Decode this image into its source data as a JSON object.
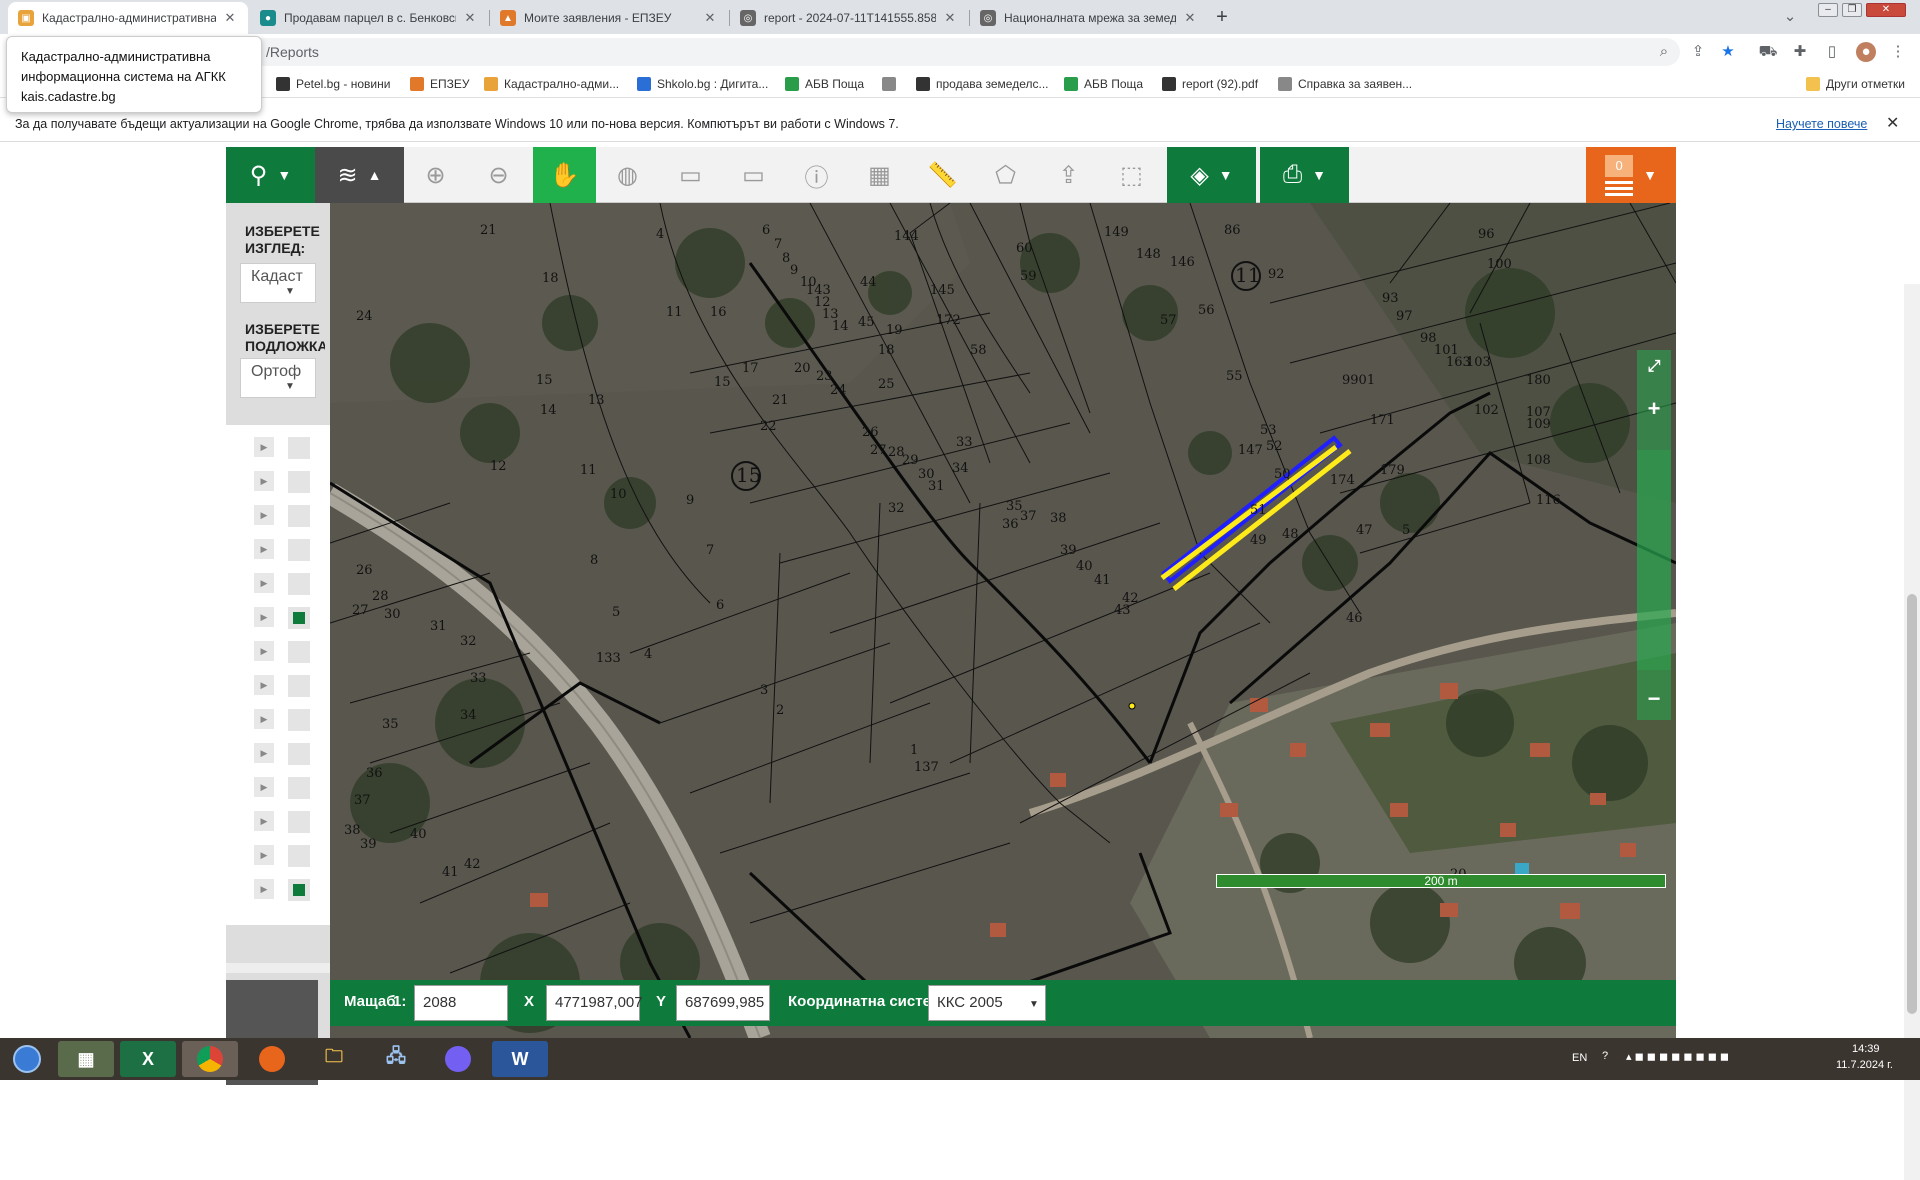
{
  "browser": {
    "tabs": [
      {
        "title": "Кадастрално-административна",
        "favicon_color": "#e8a33a",
        "active": true
      },
      {
        "title": "Продавам парцел в с. Бенковск",
        "favicon_color": "#1a8c8c",
        "active": false
      },
      {
        "title": "Моите заявления - ЕПЗЕУ",
        "favicon_color": "#e07a2a",
        "active": false
      },
      {
        "title": "report - 2024-07-11T141555.858",
        "favicon_color": "#666666",
        "active": false
      },
      {
        "title": "Националната мрежа за земед",
        "favicon_color": "#666666",
        "active": false
      }
    ],
    "tab_close": "✕",
    "new_tab": "+",
    "url_visible": "/Reports",
    "tooltip": {
      "line1": "Кадастрално-административна",
      "line2": "информационна система на АГКК",
      "line3": "kais.cadastre.bg"
    },
    "bookmarks": [
      {
        "label": "Petel.bg - новини",
        "color": "#333333"
      },
      {
        "label": "ЕПЗЕУ",
        "color": "#e07a2a"
      },
      {
        "label": "Кадастрално-адми...",
        "color": "#e8a33a"
      },
      {
        "label": "Shkolo.bg : Дигита...",
        "color": "#2a6fd6"
      },
      {
        "label": "АБВ Поща",
        "color": "#2a9d4b"
      },
      {
        "label": "",
        "color": "#888888"
      },
      {
        "label": "продава земеделс...",
        "color": "#333333"
      },
      {
        "label": "АБВ Поща",
        "color": "#2a9d4b"
      },
      {
        "label": "report (92).pdf",
        "color": "#333333"
      },
      {
        "label": "Справка за заявен...",
        "color": "#888888"
      }
    ],
    "other_bookmarks": "Други отметки",
    "infobar": {
      "message": "За да получавате бъдещи актуализации на Google Chrome, трябва да използвате Windows 10 или по-нова версия. Компютърът ви работи с Windows 7.",
      "link": "Научете повече",
      "close": "✕"
    }
  },
  "map_toolbar": {
    "counter": "0"
  },
  "left_panel": {
    "view_label": "ИЗБЕРЕТЕ ИЗГЛЕД:",
    "view_value": "Кадаст",
    "base_label": "ИЗБЕРЕТЕ ПОДЛОЖКА",
    "base_value": "Ортоф",
    "layers": [
      {
        "checked": false
      },
      {
        "checked": false
      },
      {
        "checked": false
      },
      {
        "checked": false
      },
      {
        "checked": false
      },
      {
        "checked": true
      },
      {
        "checked": false
      },
      {
        "checked": false
      },
      {
        "checked": false
      },
      {
        "checked": false
      },
      {
        "checked": false
      },
      {
        "checked": false
      },
      {
        "checked": false
      },
      {
        "checked": true
      }
    ]
  },
  "map": {
    "plot_numbers": [
      "21",
      "4",
      "6",
      "7",
      "8",
      "9",
      "10",
      "143",
      "12",
      "13",
      "14",
      "144",
      "145",
      "60",
      "59",
      "149",
      "148",
      "146",
      "86",
      "96",
      "100",
      "92",
      "93",
      "97",
      "98",
      "101",
      "163",
      "103",
      "180",
      "107",
      "102",
      "109",
      "108",
      "116",
      "18",
      "24",
      "15",
      "14",
      "13",
      "12",
      "11",
      "10",
      "9",
      "8",
      "7",
      "6",
      "5",
      "4",
      "3",
      "2",
      "1",
      "137",
      "15",
      "16",
      "11",
      "17",
      "20",
      "21",
      "22",
      "23",
      "24",
      "25",
      "26",
      "27",
      "28",
      "29",
      "30",
      "31",
      "32",
      "33",
      "34",
      "35",
      "36",
      "37",
      "38",
      "39",
      "40",
      "41",
      "42",
      "43",
      "44",
      "45",
      "18",
      "19",
      "172",
      "58",
      "57",
      "56",
      "55",
      "147",
      "53",
      "52",
      "50",
      "51",
      "49",
      "48",
      "47",
      "46",
      "174",
      "179",
      "171",
      "26",
      "27",
      "28",
      "30",
      "31",
      "32",
      "33",
      "34",
      "35",
      "36",
      "37",
      "38",
      "39",
      "40",
      "41",
      "42",
      "133",
      "20",
      "9901",
      "5"
    ],
    "circled_numbers": [
      "11",
      "15"
    ],
    "scale_bar": "200 m"
  },
  "bottom_bar": {
    "scale_label": "Мащаб",
    "scale_prefix": "1:",
    "scale_value": "2088",
    "x_label": "X",
    "x_value": "4771987,007",
    "y_label": "Y",
    "y_value": "687699,985",
    "crs_label": "Координатна система",
    "crs_value": "ККС 2005"
  },
  "taskbar": {
    "language": "EN",
    "time": "14:39",
    "date": "11.7.2024 г."
  }
}
